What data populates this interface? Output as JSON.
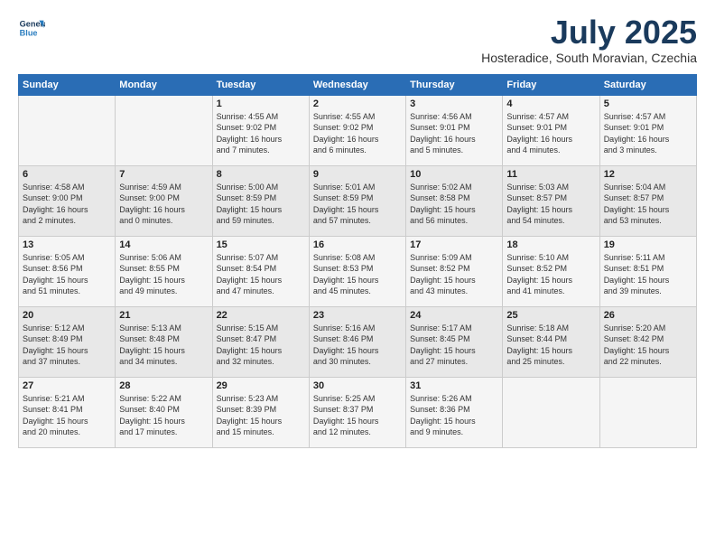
{
  "logo": {
    "line1": "General",
    "line2": "Blue"
  },
  "title": "July 2025",
  "location": "Hosteradice, South Moravian, Czechia",
  "weekdays": [
    "Sunday",
    "Monday",
    "Tuesday",
    "Wednesday",
    "Thursday",
    "Friday",
    "Saturday"
  ],
  "weeks": [
    [
      {
        "day": "",
        "info": ""
      },
      {
        "day": "",
        "info": ""
      },
      {
        "day": "1",
        "info": "Sunrise: 4:55 AM\nSunset: 9:02 PM\nDaylight: 16 hours\nand 7 minutes."
      },
      {
        "day": "2",
        "info": "Sunrise: 4:55 AM\nSunset: 9:02 PM\nDaylight: 16 hours\nand 6 minutes."
      },
      {
        "day": "3",
        "info": "Sunrise: 4:56 AM\nSunset: 9:01 PM\nDaylight: 16 hours\nand 5 minutes."
      },
      {
        "day": "4",
        "info": "Sunrise: 4:57 AM\nSunset: 9:01 PM\nDaylight: 16 hours\nand 4 minutes."
      },
      {
        "day": "5",
        "info": "Sunrise: 4:57 AM\nSunset: 9:01 PM\nDaylight: 16 hours\nand 3 minutes."
      }
    ],
    [
      {
        "day": "6",
        "info": "Sunrise: 4:58 AM\nSunset: 9:00 PM\nDaylight: 16 hours\nand 2 minutes."
      },
      {
        "day": "7",
        "info": "Sunrise: 4:59 AM\nSunset: 9:00 PM\nDaylight: 16 hours\nand 0 minutes."
      },
      {
        "day": "8",
        "info": "Sunrise: 5:00 AM\nSunset: 8:59 PM\nDaylight: 15 hours\nand 59 minutes."
      },
      {
        "day": "9",
        "info": "Sunrise: 5:01 AM\nSunset: 8:59 PM\nDaylight: 15 hours\nand 57 minutes."
      },
      {
        "day": "10",
        "info": "Sunrise: 5:02 AM\nSunset: 8:58 PM\nDaylight: 15 hours\nand 56 minutes."
      },
      {
        "day": "11",
        "info": "Sunrise: 5:03 AM\nSunset: 8:57 PM\nDaylight: 15 hours\nand 54 minutes."
      },
      {
        "day": "12",
        "info": "Sunrise: 5:04 AM\nSunset: 8:57 PM\nDaylight: 15 hours\nand 53 minutes."
      }
    ],
    [
      {
        "day": "13",
        "info": "Sunrise: 5:05 AM\nSunset: 8:56 PM\nDaylight: 15 hours\nand 51 minutes."
      },
      {
        "day": "14",
        "info": "Sunrise: 5:06 AM\nSunset: 8:55 PM\nDaylight: 15 hours\nand 49 minutes."
      },
      {
        "day": "15",
        "info": "Sunrise: 5:07 AM\nSunset: 8:54 PM\nDaylight: 15 hours\nand 47 minutes."
      },
      {
        "day": "16",
        "info": "Sunrise: 5:08 AM\nSunset: 8:53 PM\nDaylight: 15 hours\nand 45 minutes."
      },
      {
        "day": "17",
        "info": "Sunrise: 5:09 AM\nSunset: 8:52 PM\nDaylight: 15 hours\nand 43 minutes."
      },
      {
        "day": "18",
        "info": "Sunrise: 5:10 AM\nSunset: 8:52 PM\nDaylight: 15 hours\nand 41 minutes."
      },
      {
        "day": "19",
        "info": "Sunrise: 5:11 AM\nSunset: 8:51 PM\nDaylight: 15 hours\nand 39 minutes."
      }
    ],
    [
      {
        "day": "20",
        "info": "Sunrise: 5:12 AM\nSunset: 8:49 PM\nDaylight: 15 hours\nand 37 minutes."
      },
      {
        "day": "21",
        "info": "Sunrise: 5:13 AM\nSunset: 8:48 PM\nDaylight: 15 hours\nand 34 minutes."
      },
      {
        "day": "22",
        "info": "Sunrise: 5:15 AM\nSunset: 8:47 PM\nDaylight: 15 hours\nand 32 minutes."
      },
      {
        "day": "23",
        "info": "Sunrise: 5:16 AM\nSunset: 8:46 PM\nDaylight: 15 hours\nand 30 minutes."
      },
      {
        "day": "24",
        "info": "Sunrise: 5:17 AM\nSunset: 8:45 PM\nDaylight: 15 hours\nand 27 minutes."
      },
      {
        "day": "25",
        "info": "Sunrise: 5:18 AM\nSunset: 8:44 PM\nDaylight: 15 hours\nand 25 minutes."
      },
      {
        "day": "26",
        "info": "Sunrise: 5:20 AM\nSunset: 8:42 PM\nDaylight: 15 hours\nand 22 minutes."
      }
    ],
    [
      {
        "day": "27",
        "info": "Sunrise: 5:21 AM\nSunset: 8:41 PM\nDaylight: 15 hours\nand 20 minutes."
      },
      {
        "day": "28",
        "info": "Sunrise: 5:22 AM\nSunset: 8:40 PM\nDaylight: 15 hours\nand 17 minutes."
      },
      {
        "day": "29",
        "info": "Sunrise: 5:23 AM\nSunset: 8:39 PM\nDaylight: 15 hours\nand 15 minutes."
      },
      {
        "day": "30",
        "info": "Sunrise: 5:25 AM\nSunset: 8:37 PM\nDaylight: 15 hours\nand 12 minutes."
      },
      {
        "day": "31",
        "info": "Sunrise: 5:26 AM\nSunset: 8:36 PM\nDaylight: 15 hours\nand 9 minutes."
      },
      {
        "day": "",
        "info": ""
      },
      {
        "day": "",
        "info": ""
      }
    ]
  ]
}
